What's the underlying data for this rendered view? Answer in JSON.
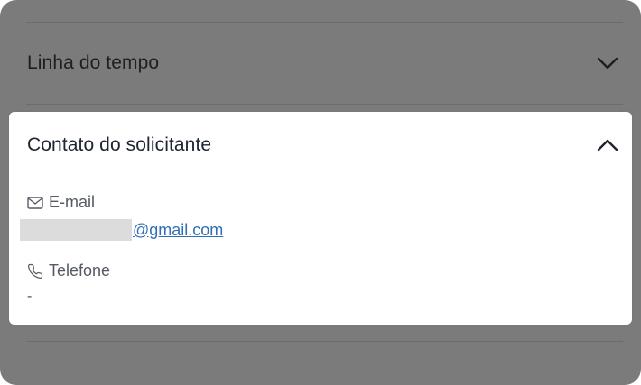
{
  "colors": {
    "overlay_background": "#7b7b7b",
    "card_background": "#ffffff",
    "link": "#2f6fb5",
    "title": "#1d2433",
    "label": "#555a63",
    "redaction": "#dcdcdc"
  },
  "sections": {
    "timeline": {
      "title": "Linha do tempo",
      "icon": "chevron-down-icon"
    },
    "requester_contact": {
      "title": "Contato do solicitante",
      "icon": "chevron-up-icon",
      "email": {
        "label": "E-mail",
        "icon": "mail-icon",
        "value_visible_part": "@gmail.com"
      },
      "phone": {
        "label": "Telefone",
        "icon": "phone-icon",
        "value": "-"
      }
    }
  }
}
